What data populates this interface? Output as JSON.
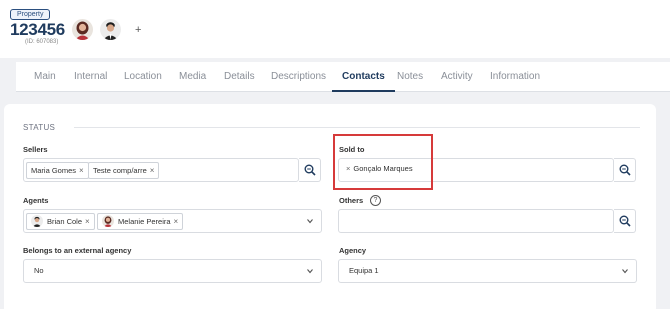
{
  "header": {
    "badge": "Property",
    "number": "123456",
    "id_text": "(ID: 607083)",
    "add_label": "+"
  },
  "tabs": [
    {
      "label": "Main",
      "active": false
    },
    {
      "label": "Internal",
      "active": false
    },
    {
      "label": "Location",
      "active": false
    },
    {
      "label": "Media",
      "active": false
    },
    {
      "label": "Details",
      "active": false
    },
    {
      "label": "Descriptions",
      "active": false
    },
    {
      "label": "Contacts",
      "active": true
    },
    {
      "label": "Notes",
      "active": false
    },
    {
      "label": "Activity",
      "active": false
    },
    {
      "label": "Information",
      "active": false
    }
  ],
  "section": {
    "title": "STATUS"
  },
  "sellers": {
    "label": "Sellers",
    "chips": [
      "Maria Gomes",
      "Teste comp/arre"
    ]
  },
  "sold_to": {
    "label": "Sold to",
    "chip": "Gonçalo Marques"
  },
  "agents": {
    "label": "Agents",
    "chips": [
      "Brian Cole",
      "Melanie Pereira"
    ]
  },
  "others": {
    "label": "Others",
    "help": "?"
  },
  "external_agency": {
    "label": "Belongs to an external agency",
    "value": "No"
  },
  "agency": {
    "label": "Agency",
    "value": "Equipa 1"
  },
  "colors": {
    "accent": "#1f3b5e",
    "highlight": "#d63a3a"
  }
}
